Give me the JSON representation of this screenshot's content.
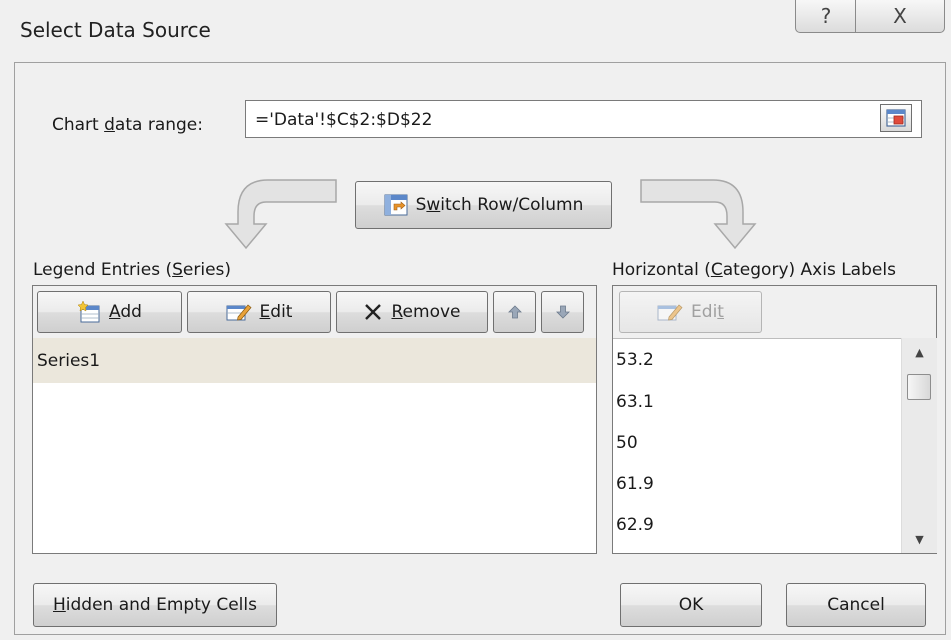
{
  "window": {
    "title": "Select Data Source",
    "help_glyph": "?",
    "close_glyph": "X"
  },
  "range": {
    "label_pre": "Chart ",
    "label_accel": "d",
    "label_post": "ata range:",
    "value": "='Data'!$C$2:$D$22"
  },
  "switch_button": {
    "pre": "S",
    "accel": "w",
    "post": "itch Row/Column"
  },
  "legend": {
    "title_pre": "Legend Entries (",
    "title_accel": "S",
    "title_post": "eries)",
    "add_accel": "A",
    "add_post": "dd",
    "edit_accel": "E",
    "edit_post": "dit",
    "remove_accel": "R",
    "remove_post": "emove",
    "series": [
      "Series1"
    ]
  },
  "axis": {
    "title_pre": "Horizontal (",
    "title_accel": "C",
    "title_post": "ategory) Axis Labels",
    "edit_pre": "Edi",
    "edit_accel": "t",
    "labels": [
      "53.2",
      "63.1",
      "50",
      "61.9",
      "62.9"
    ]
  },
  "footer": {
    "hidden_accel": "H",
    "hidden_post": "idden and Empty Cells",
    "ok_label": "OK",
    "cancel_label": "Cancel"
  },
  "colors": {
    "selected_row": "#ebe7dc",
    "dialog_bg": "#f0f0f0",
    "arrow_fill": "#e3e3e3",
    "arrow_stroke": "#a8a8a8"
  }
}
